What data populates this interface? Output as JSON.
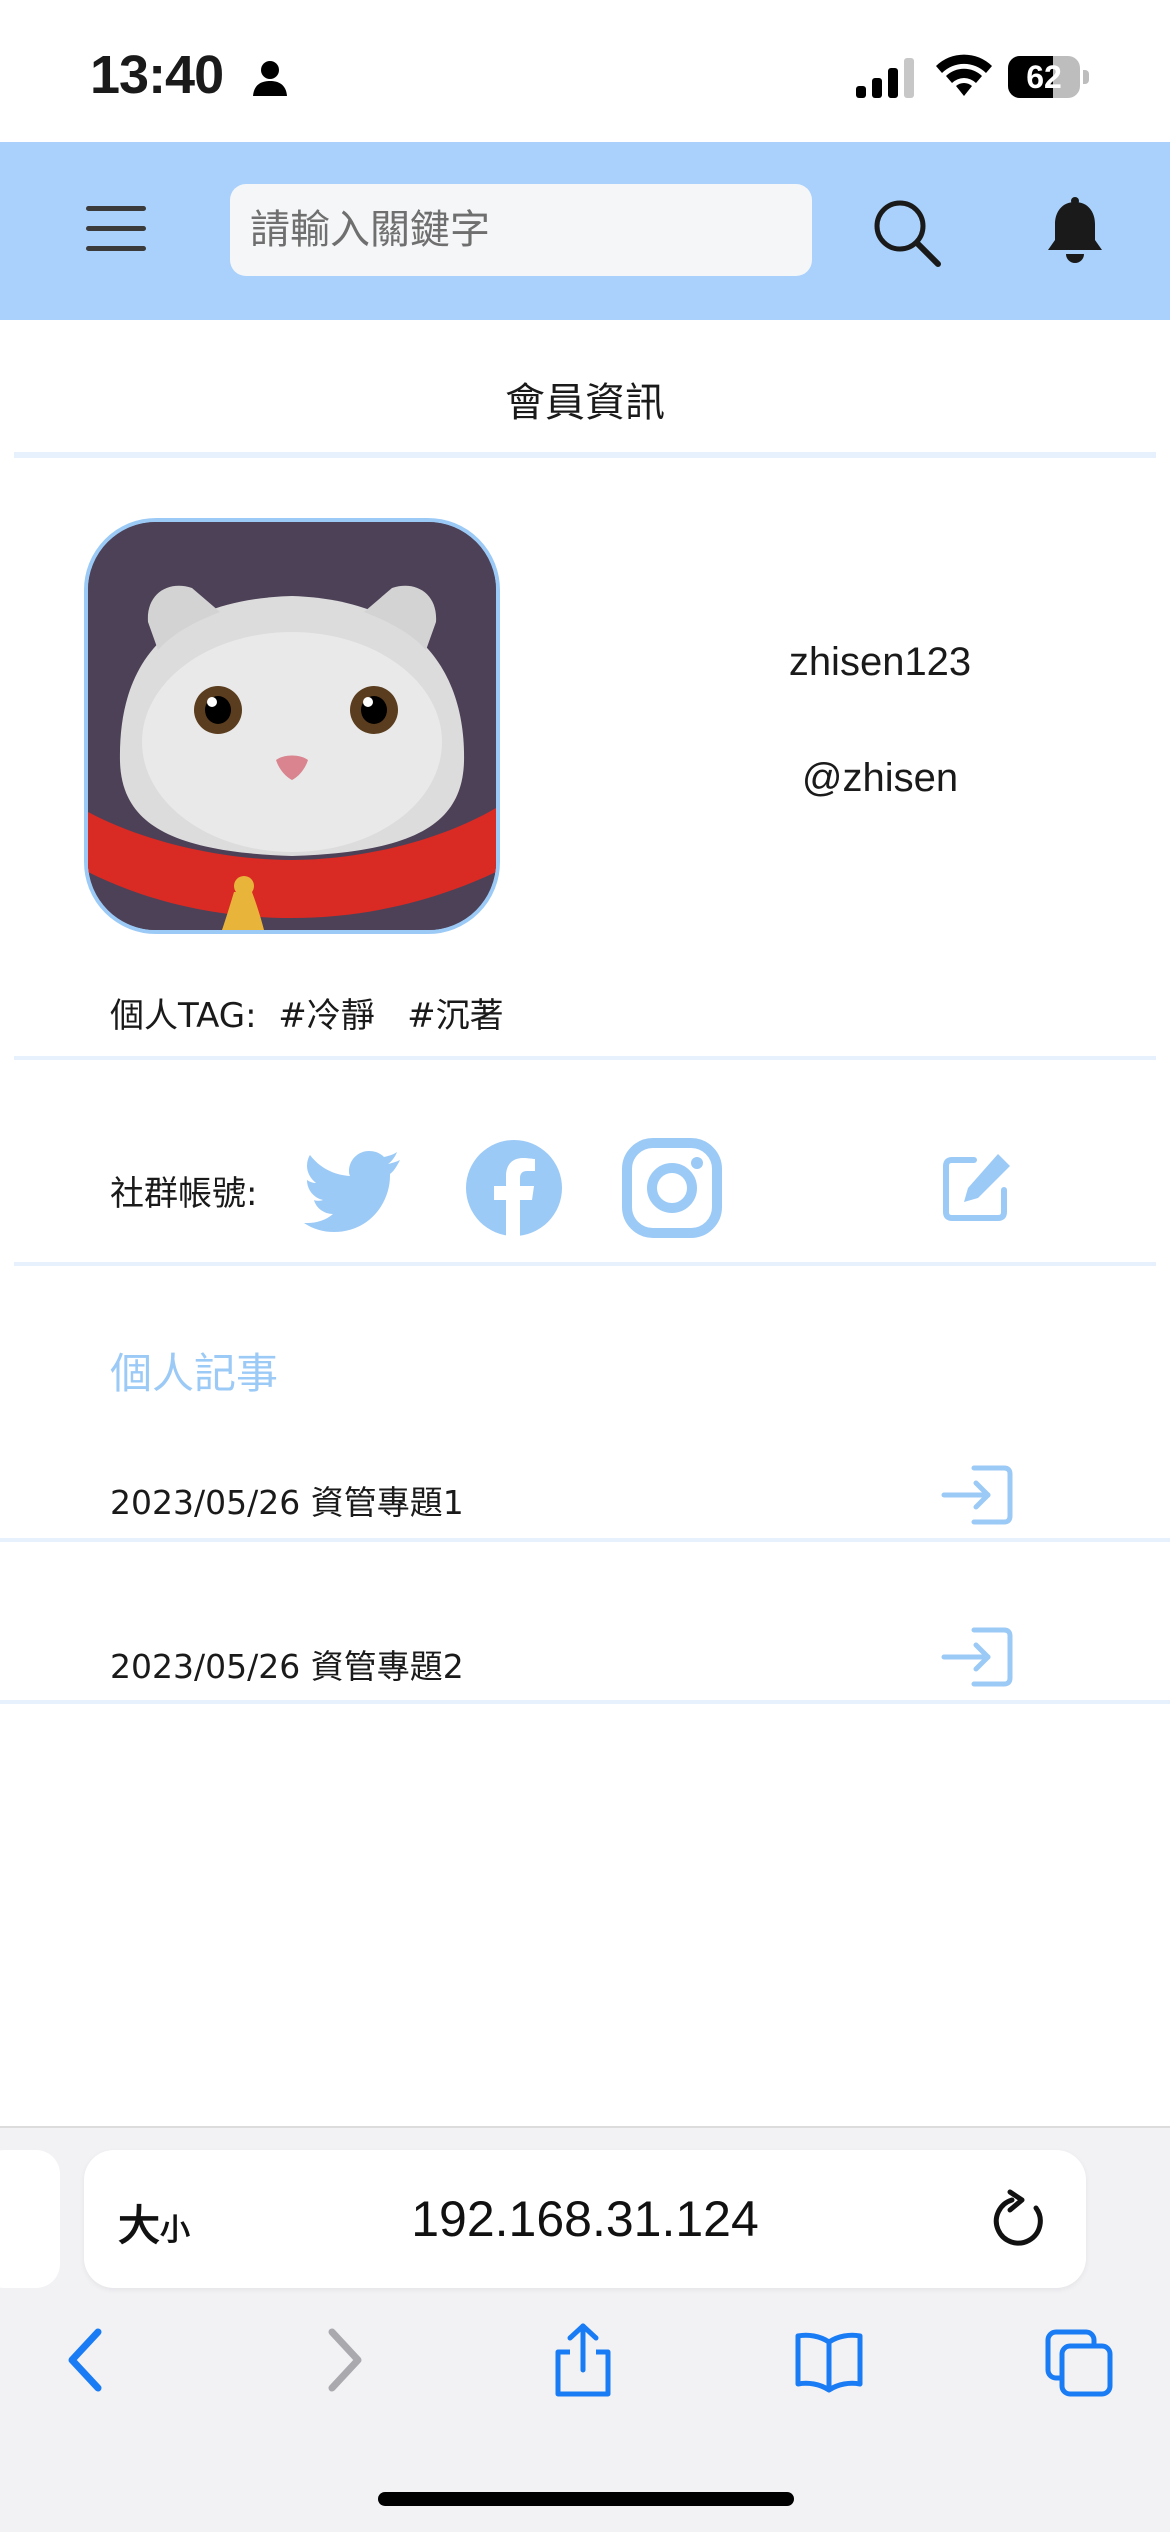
{
  "status_bar": {
    "time": "13:40",
    "battery": "62",
    "battery_level": 0.62
  },
  "header": {
    "search_placeholder": "請輸入關鍵字"
  },
  "page": {
    "title": "會員資訊"
  },
  "profile": {
    "username": "zhisen123",
    "handle": "@zhisen",
    "tag_label": "個人TAG:",
    "tags": [
      "#冷靜",
      "#沉著"
    ]
  },
  "social": {
    "label": "社群帳號:",
    "icons": [
      "twitter-icon",
      "facebook-icon",
      "instagram-icon",
      "edit-icon"
    ]
  },
  "posts": {
    "section_title": "個人記事",
    "items": [
      {
        "title": "2023/05/26 資管專題1"
      },
      {
        "title": "2023/05/26 資管專題2"
      }
    ]
  },
  "browser": {
    "text_size_big": "大",
    "text_size_small": "小",
    "url": "192.168.31.124"
  },
  "colors": {
    "header_bg": "#a9d1fb",
    "accent": "#9ccaf6",
    "divider": "#e6f1fd",
    "ios_blue": "#1a7cf5"
  }
}
